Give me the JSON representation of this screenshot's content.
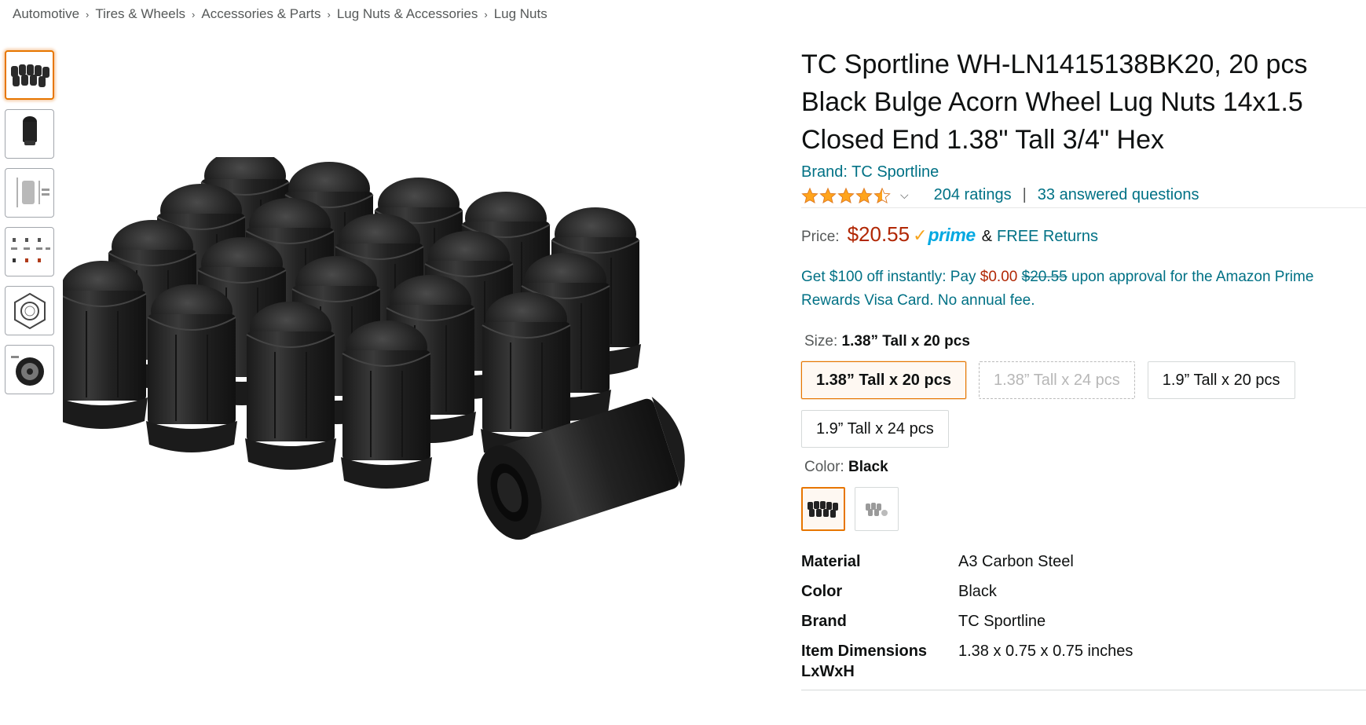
{
  "breadcrumb": [
    "Automotive",
    "Tires & Wheels",
    "Accessories & Parts",
    "Lug Nuts & Accessories",
    "Lug Nuts"
  ],
  "breadcrumb_separator": "›",
  "thumbnails": [
    {
      "name": "lug-nut-set"
    },
    {
      "name": "single-lug-nut"
    },
    {
      "name": "lug-nut-dimensions"
    },
    {
      "name": "lug-nut-variants"
    },
    {
      "name": "hex-diagram"
    },
    {
      "name": "wheel-install"
    }
  ],
  "product": {
    "title": "TC Sportline WH-LN1415138BK20, 20 pcs Black Bulge Acorn Wheel Lug Nuts 14x1.5 Closed End 1.38\" Tall 3/4\" Hex",
    "brand_link": "Brand: TC Sportline",
    "rating_stars": 4.5,
    "ratings_count": "204 ratings",
    "answered_questions": "33 answered questions",
    "pipe": "|"
  },
  "price": {
    "label": "Price:",
    "value": "$20.55",
    "prime_check": "✓",
    "prime_word": "prime",
    "amp": "&",
    "returns": "FREE Returns"
  },
  "promo": {
    "lead": "Get $100 off instantly: Pay ",
    "pay_price": "$0.00",
    "strike_price": "$20.55",
    "tail": " upon approval for the Amazon Prime Rewards Visa Card. No annual fee."
  },
  "size": {
    "label": "Size: ",
    "selected": "1.38” Tall x 20 pcs",
    "options": [
      {
        "label": "1.38” Tall x 20 pcs",
        "state": "selected"
      },
      {
        "label": "1.38” Tall x 24 pcs",
        "state": "unavailable"
      },
      {
        "label": "1.9” Tall x 20 pcs",
        "state": "available"
      },
      {
        "label": "1.9” Tall x 24 pcs",
        "state": "available"
      }
    ]
  },
  "color": {
    "label": "Color: ",
    "selected": "Black",
    "swatches": [
      {
        "name": "black",
        "state": "selected"
      },
      {
        "name": "chrome",
        "state": "available"
      }
    ]
  },
  "specs": [
    {
      "key": "Material",
      "value": "A3 Carbon Steel"
    },
    {
      "key": "Color",
      "value": "Black"
    },
    {
      "key": "Brand",
      "value": "TC Sportline"
    },
    {
      "key": "Item Dimensions LxWxH",
      "value": "1.38 x 0.75 x 0.75 inches"
    }
  ],
  "colors": {
    "link": "#007185",
    "price": "#b12704",
    "prime": "#00a8e1",
    "selected_border": "#e77600",
    "star": "#ffa41c"
  }
}
